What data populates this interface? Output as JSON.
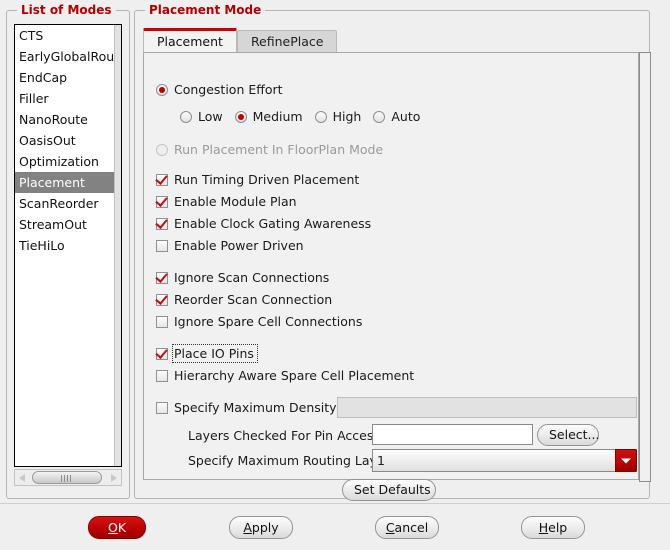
{
  "modes_panel": {
    "title": "List of Modes",
    "items": [
      {
        "label": "CTS",
        "selected": false
      },
      {
        "label": "EarlyGlobalRoute",
        "selected": false
      },
      {
        "label": "EndCap",
        "selected": false
      },
      {
        "label": "Filler",
        "selected": false
      },
      {
        "label": "NanoRoute",
        "selected": false
      },
      {
        "label": "OasisOut",
        "selected": false
      },
      {
        "label": "Optimization",
        "selected": false
      },
      {
        "label": "Placement",
        "selected": true
      },
      {
        "label": "ScanReorder",
        "selected": false
      },
      {
        "label": "StreamOut",
        "selected": false
      },
      {
        "label": "TieHiLo",
        "selected": false
      }
    ]
  },
  "placement_panel": {
    "title": "Placement Mode",
    "tabs": [
      {
        "label": "Placement",
        "active": true
      },
      {
        "label": "RefinePlace",
        "active": false
      }
    ],
    "congestion": {
      "label": "Congestion Effort",
      "checked": true,
      "options": [
        {
          "label": "Low",
          "selected": false
        },
        {
          "label": "Medium",
          "selected": true
        },
        {
          "label": "High",
          "selected": false
        },
        {
          "label": "Auto",
          "selected": false
        }
      ]
    },
    "floorplan_mode": {
      "label": "Run Placement In FloorPlan Mode",
      "checked": false,
      "disabled": true
    },
    "checks_group_1": [
      {
        "label": "Run Timing Driven Placement",
        "checked": true
      },
      {
        "label": "Enable Module Plan",
        "checked": true
      },
      {
        "label": "Enable Clock Gating Awareness",
        "checked": true
      },
      {
        "label": "Enable Power Driven",
        "checked": false
      }
    ],
    "checks_group_2": [
      {
        "label": "Ignore Scan Connections",
        "checked": true
      },
      {
        "label": "Reorder Scan Connection",
        "checked": true
      },
      {
        "label": "Ignore Spare Cell Connections",
        "checked": false
      }
    ],
    "checks_group_3": [
      {
        "label": "Place IO Pins",
        "checked": true,
        "focused": true
      },
      {
        "label": "Hierarchy Aware Spare Cell Placement",
        "checked": false,
        "focused": false
      }
    ],
    "max_density": {
      "label": "Specify Maximum Density",
      "checked": false,
      "value": "",
      "placeholder": "",
      "disabled": true
    },
    "pin_access": {
      "label": "Layers Checked For Pin Access",
      "value": "",
      "placeholder": "",
      "button_label": "Select..."
    },
    "routing_layer": {
      "label": "Specify Maximum Routing Layer",
      "value": "1"
    },
    "set_defaults_label": "Set Defaults"
  },
  "buttons": {
    "ok": {
      "prefix": "",
      "mnemonic": "O",
      "suffix": "K"
    },
    "apply": {
      "prefix": "",
      "mnemonic": "A",
      "suffix": "pply"
    },
    "cancel": {
      "prefix": "",
      "mnemonic": "C",
      "suffix": "ancel"
    },
    "help": {
      "prefix": "",
      "mnemonic": "H",
      "suffix": "elp"
    }
  },
  "colors": {
    "accent_red": "#b40000",
    "selection_gray": "#828282",
    "background": "#efefef"
  }
}
